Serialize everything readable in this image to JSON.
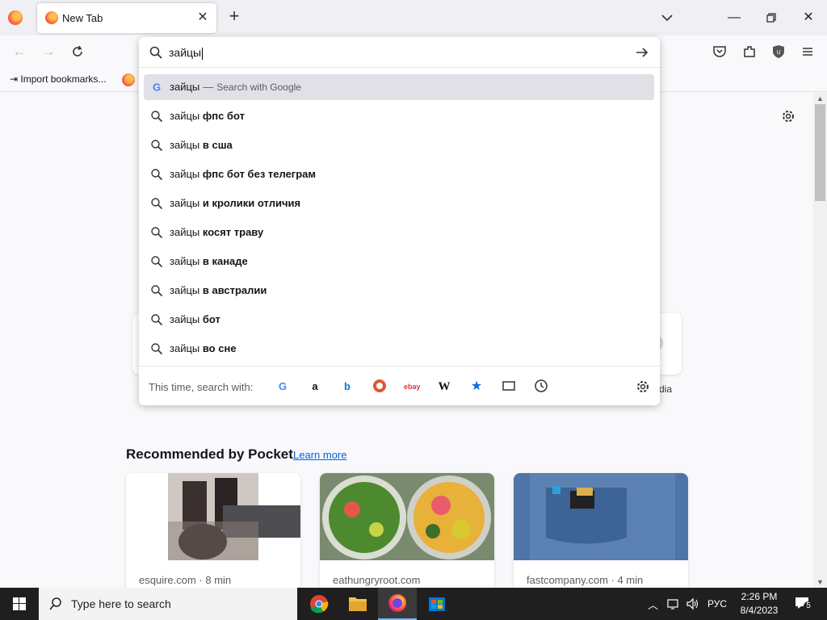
{
  "tabstrip": {
    "tab_title": "New Tab"
  },
  "bookmarks": {
    "import_label": "Import bookmarks..."
  },
  "urlbar": {
    "value": "зайцы",
    "suggestions": [
      {
        "prefix": "зайцы",
        "bold": "",
        "sep": "—",
        "action": "Search with Google",
        "icon": "google-icon"
      },
      {
        "prefix": "зайцы ",
        "bold": "фпс бот"
      },
      {
        "prefix": "зайцы ",
        "bold": "в сша"
      },
      {
        "prefix": "зайцы ",
        "bold": "фпс бот без телеграм"
      },
      {
        "prefix": "зайцы ",
        "bold": "и кролики отличия"
      },
      {
        "prefix": "зайцы ",
        "bold": "косят траву"
      },
      {
        "prefix": "зайцы ",
        "bold": "в канаде"
      },
      {
        "prefix": "зайцы ",
        "bold": "в австралии"
      },
      {
        "prefix": "зайцы ",
        "bold": "бот"
      },
      {
        "prefix": "зайцы ",
        "bold": "во сне"
      }
    ],
    "oneoff_label": "This time, search with:",
    "oneoff_engines": [
      "google-icon",
      "amazon-icon",
      "bing-icon",
      "duckduckgo-icon",
      "ebay-icon",
      "wikipedia-icon",
      "bookmarks-star-icon",
      "tabs-icon",
      "history-icon"
    ]
  },
  "page": {
    "topsite_partial_label": "dia",
    "pocket_title": "Recommended by Pocket",
    "pocket_link": "Learn more",
    "stories": [
      {
        "source": "esquire.com · 8 min"
      },
      {
        "source": "eathungryroot.com"
      },
      {
        "source": "fastcompany.com · 4 min"
      }
    ]
  },
  "taskbar": {
    "search_placeholder": "Type here to search",
    "lang": "РУС",
    "time": "2:26 PM",
    "date": "8/4/2023",
    "notif_count": "5"
  },
  "colors": {
    "accent": "#0061e0",
    "taskbar_bg": "#1f1f1f",
    "selected_row": "#e0e0e6"
  }
}
